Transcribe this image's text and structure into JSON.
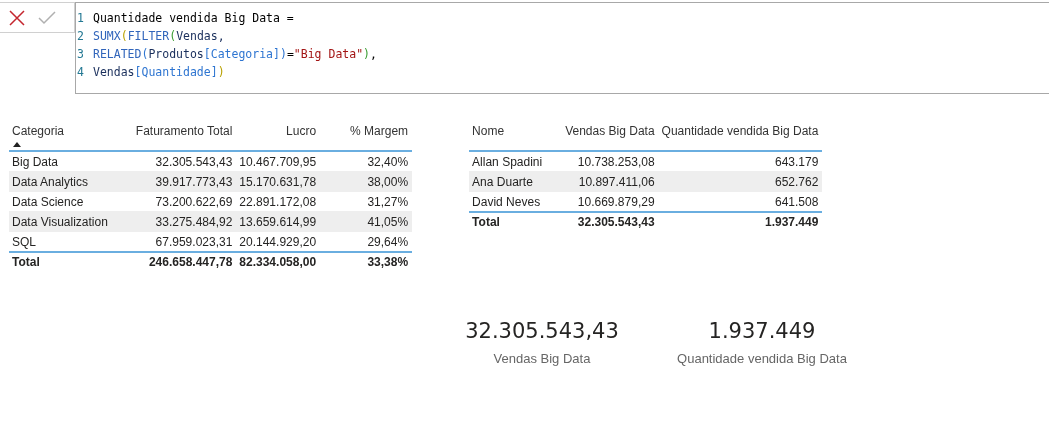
{
  "formula_bar": {
    "lines": [
      {
        "number": "1",
        "tokens": [
          {
            "kind": "plain",
            "text": "Quantidade vendida Big Data ="
          }
        ]
      },
      {
        "number": "2",
        "tokens": [
          {
            "kind": "function",
            "text": "SUMX"
          },
          {
            "kind": "paren_outer",
            "text": "("
          },
          {
            "kind": "function",
            "text": "FILTER"
          },
          {
            "kind": "paren_inner",
            "text": "("
          },
          {
            "kind": "table",
            "text": "Vendas,"
          }
        ]
      },
      {
        "number": "3",
        "tokens": [
          {
            "kind": "function",
            "text": "RELATED"
          },
          {
            "kind": "paren_deep",
            "text": "("
          },
          {
            "kind": "table",
            "text": "Produtos"
          },
          {
            "kind": "column",
            "text": "[Categoria]"
          },
          {
            "kind": "paren_deep",
            "text": ")"
          },
          {
            "kind": "plain",
            "text": "="
          },
          {
            "kind": "string",
            "text": "\"Big Data\""
          },
          {
            "kind": "paren_inner",
            "text": ")"
          },
          {
            "kind": "plain",
            "text": ","
          }
        ]
      },
      {
        "number": "4",
        "tokens": [
          {
            "kind": "table",
            "text": "Vendas"
          },
          {
            "kind": "column",
            "text": "[Quantidade]"
          },
          {
            "kind": "paren_outer",
            "text": ")"
          }
        ]
      }
    ]
  },
  "category_table": {
    "columns": [
      "Categoria",
      "Faturamento Total",
      "Lucro",
      "% Margem"
    ],
    "rows": [
      [
        "Big Data",
        "32.305.543,43",
        "10.467.709,95",
        "32,40%"
      ],
      [
        "Data Analytics",
        "39.917.773,43",
        "15.170.631,78",
        "38,00%"
      ],
      [
        "Data Science",
        "73.200.622,69",
        "22.891.172,08",
        "31,27%"
      ],
      [
        "Data Visualization",
        "33.275.484,92",
        "13.659.614,99",
        "41,05%"
      ],
      [
        "SQL",
        "67.959.023,31",
        "20.144.929,20",
        "29,64%"
      ]
    ],
    "total": [
      "Total",
      "246.658.447,78",
      "82.334.058,00",
      "33,38%"
    ]
  },
  "seller_table": {
    "columns": [
      "Nome",
      "Vendas Big Data",
      "Quantidade vendida Big Data"
    ],
    "rows": [
      [
        "Allan Spadini",
        "10.738.253,08",
        "643.179"
      ],
      [
        "Ana Duarte",
        "10.897.411,06",
        "652.762"
      ],
      [
        "David Neves",
        "10.669.879,29",
        "641.508"
      ]
    ],
    "total": [
      "Total",
      "32.305.543,43",
      "1.937.449"
    ]
  },
  "cards": [
    {
      "value": "32.305.543,43",
      "label": "Vendas Big Data"
    },
    {
      "value": "1.937.449",
      "label": "Quantidade vendida Big Data"
    }
  ]
}
